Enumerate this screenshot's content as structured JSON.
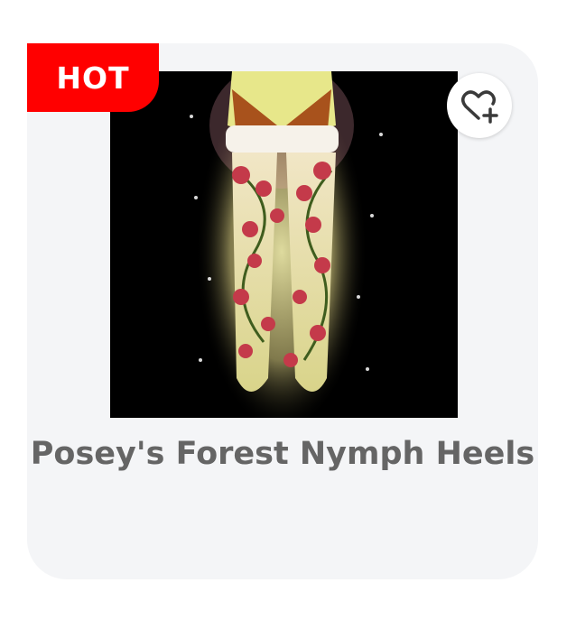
{
  "item": {
    "badge": "HOT",
    "name": "Posey's Forest Nymph Heels",
    "favorite_icon": "heart-plus-icon"
  },
  "colors": {
    "badge_bg": "#ff0000",
    "card_bg": "#f4f5f7",
    "title_text": "#656565",
    "image_bg": "#000000"
  }
}
